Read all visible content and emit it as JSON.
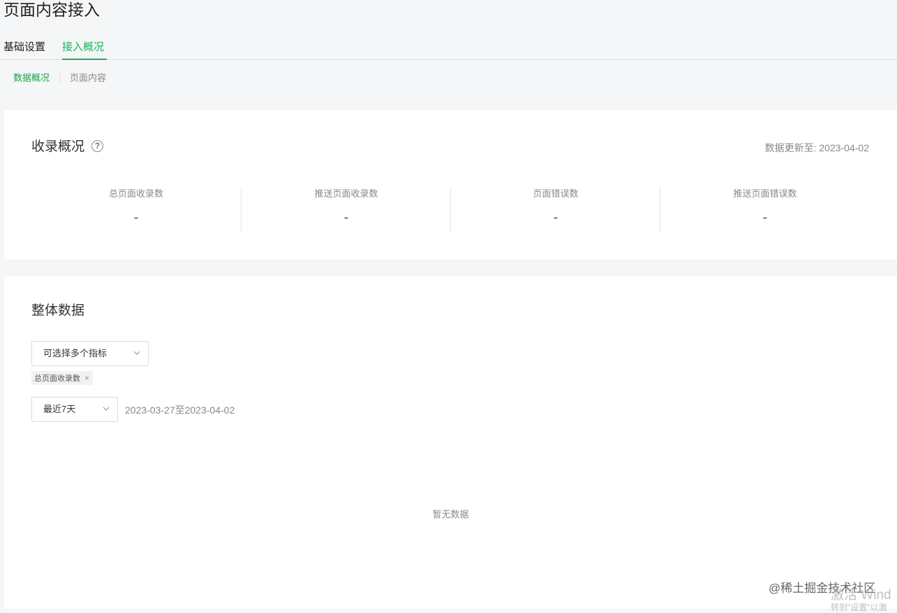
{
  "page": {
    "title": "页面内容接入"
  },
  "tabs": [
    {
      "label": "基础设置",
      "active": false
    },
    {
      "label": "接入概况",
      "active": true
    }
  ],
  "subtabs": [
    {
      "label": "数据概况",
      "active": true
    },
    {
      "label": "页面内容",
      "active": false
    }
  ],
  "overview": {
    "title": "收录概况",
    "help_icon": "question-circle-icon",
    "update_time": "数据更新至: 2023-04-02",
    "stats": [
      {
        "label": "总页面收录数",
        "value": "-"
      },
      {
        "label": "推送页面收录数",
        "value": "-"
      },
      {
        "label": "页面错误数",
        "value": "-"
      },
      {
        "label": "推送页面错误数",
        "value": "-"
      }
    ]
  },
  "overall": {
    "title": "整体数据",
    "metric_select": {
      "placeholder": "可选择多个指标",
      "icon": "chevron-down-icon"
    },
    "selected_tags": [
      {
        "label": "总页面收录数",
        "close": "×"
      }
    ],
    "range_select": {
      "value": "最近7天",
      "icon": "chevron-down-icon"
    },
    "date_range": "2023-03-27至2023-04-02",
    "empty_text": "暂无数据"
  },
  "overlay": {
    "watermark": "@稀土掘金技术社区",
    "activate_title": "激活 Wind",
    "activate_sub": "转到\"设置\"以激"
  },
  "colors": {
    "accent": "#19b35e",
    "background": "#f5f6f7",
    "card": "#ffffff",
    "muted_text": "#888888"
  }
}
